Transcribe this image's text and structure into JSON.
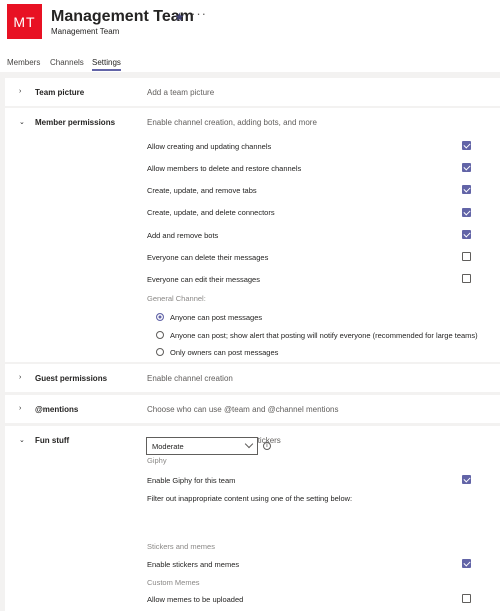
{
  "header": {
    "avatar_initials": "MT",
    "avatar_color": "#e81123",
    "title": "Management Team",
    "subtitle": "Management Team",
    "star_icon": "star-icon",
    "more_icon": "more-icon"
  },
  "tabs": [
    {
      "label": "Members"
    },
    {
      "label": "Channels"
    },
    {
      "label": "Settings",
      "active": true
    }
  ],
  "accent_color": "#6264a7",
  "sections": {
    "team_picture": {
      "title": "Team picture",
      "desc": "Add a team picture",
      "expanded": false
    },
    "member_permissions": {
      "title": "Member permissions",
      "desc": "Enable channel creation, adding bots, and more",
      "expanded": true,
      "options": [
        {
          "label": "Allow creating and updating channels",
          "checked": true
        },
        {
          "label": "Allow members to delete and restore channels",
          "checked": true
        },
        {
          "label": "Create, update, and remove tabs",
          "checked": true
        },
        {
          "label": "Create, update, and delete connectors",
          "checked": true
        },
        {
          "label": "Add and remove bots",
          "checked": true
        },
        {
          "label": "Everyone can delete their messages",
          "checked": false
        },
        {
          "label": "Everyone can edit their messages",
          "checked": false
        }
      ],
      "general_channel_label": "General Channel:",
      "radios": [
        {
          "label": "Anyone can post messages",
          "selected": true
        },
        {
          "label": "Anyone can post; show alert that posting will notify everyone (recommended for large teams)",
          "selected": false
        },
        {
          "label": "Only owners can post messages",
          "selected": false
        }
      ]
    },
    "guest_permissions": {
      "title": "Guest permissions",
      "desc": "Enable channel creation",
      "expanded": false
    },
    "mentions": {
      "title": "@mentions",
      "desc": "Choose who can use @team and @channel mentions",
      "expanded": false
    },
    "fun_stuff": {
      "title": "Fun stuff",
      "desc": "Allow emoji, memes, GIFs, or stickers",
      "expanded": true,
      "giphy_label": "Giphy",
      "enable_giphy": {
        "label": "Enable Giphy for this team",
        "checked": true
      },
      "filter_label": "Filter out inappropriate content using one of the setting below:",
      "filter_value": "Moderate",
      "stickers_label": "Stickers and memes",
      "enable_stickers": {
        "label": "Enable stickers and memes",
        "checked": true
      },
      "custom_memes_label": "Custom Memes",
      "allow_memes": {
        "label": "Allow memes to be uploaded",
        "checked": false
      }
    }
  }
}
